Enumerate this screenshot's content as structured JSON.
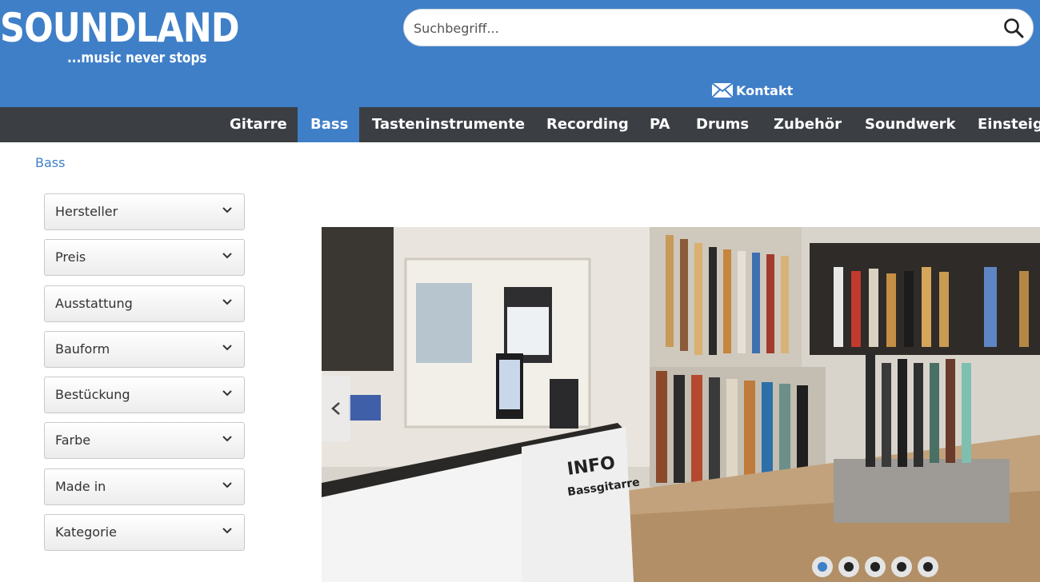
{
  "header": {
    "logo_main": "SOUNDLAND",
    "logo_sub": "...music never stops",
    "search_placeholder": "Suchbegriff...",
    "contact_label": "Kontakt"
  },
  "nav": {
    "items": [
      "Gitarre",
      "Bass",
      "Tasteninstrumente",
      "Recording",
      "PA",
      "Drums",
      "Zubehör",
      "Soundwerk",
      "Einsteiger"
    ],
    "active": "Bass"
  },
  "breadcrumb": "Bass",
  "filters": [
    "Hersteller",
    "Preis",
    "Ausstattung",
    "Bauform",
    "Bestückung",
    "Farbe",
    "Made in",
    "Kategorie"
  ],
  "slider": {
    "slide_count": 5,
    "active_index": 0,
    "slide_text": [
      "INFO",
      "Bassgitarre"
    ]
  },
  "colors": {
    "brand_blue": "#3f7fc8",
    "nav_dark": "#3b3f44"
  }
}
